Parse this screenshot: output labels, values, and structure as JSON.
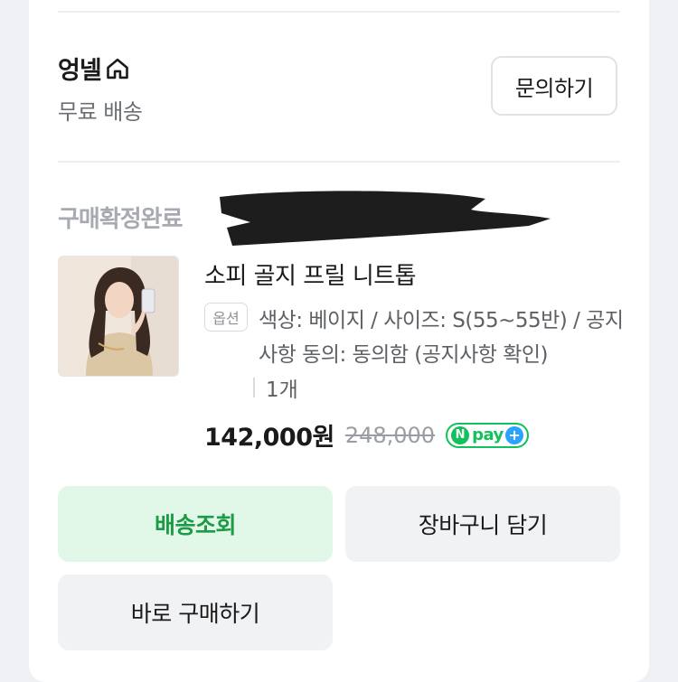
{
  "store": {
    "name": "엉넬",
    "shipping": "무료 배송",
    "inquiry_label": "문의하기"
  },
  "order": {
    "status": "구매확정완료",
    "product_name": "소피 골지 프릴 니트톱",
    "option_badge": "옵션",
    "option_text": "색상: 베이지 / 사이즈: S(55~55반) / 공지사항 동의: 동의함 (공지사항 확인)",
    "quantity": "1개",
    "price": "142,000원",
    "original_price": "248,000",
    "npay": {
      "n": "N",
      "pay": "pay",
      "plus": "+"
    }
  },
  "actions": {
    "track_label": "배송조회",
    "cart_label": "장바구니 담기",
    "buy_label": "바로 구매하기"
  },
  "colors": {
    "green": "#1c9a45",
    "npay_green": "#11c15b",
    "npay_blue": "#2aa3ff"
  }
}
